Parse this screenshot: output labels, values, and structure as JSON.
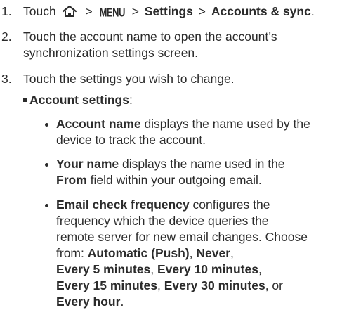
{
  "steps": [
    {
      "number": "1.",
      "touch": "Touch",
      "sep": ">",
      "menu": "MENU",
      "settings": "Settings",
      "accounts_sync": "Accounts & sync",
      "period": "."
    },
    {
      "number": "2.",
      "line1": "Touch the account name to open the account’s",
      "line2": "synchronization settings screen."
    },
    {
      "number": "3.",
      "text": "Touch the settings you wish to change."
    }
  ],
  "account_settings": {
    "label": "Account settings",
    "colon": ":"
  },
  "bullets": [
    {
      "term": "Account name",
      "line1_rest": " displays the name used by the",
      "line2": "device to track the account."
    },
    {
      "term": "Your name",
      "line1_rest": " displays the name used in the",
      "line2_term": "From",
      "line2_rest": " field within your outgoing email."
    },
    {
      "term": "Email check frequency",
      "line1_rest": " configures the",
      "line2": "frequency which the device queries the",
      "line3": "remote server for new email changes. Choose",
      "line4_text": "from: ",
      "opt_automatic": "Automatic (Push)",
      "opt_never": "Never",
      "opt_5": "Every 5 minutes",
      "opt_10": "Every 10 minutes",
      "opt_15": "Every 15 minutes",
      "opt_30": "Every 30 minutes",
      "opt_hour": "Every hour",
      "comma": ",",
      "or_text": ", or",
      "period": "."
    }
  ]
}
